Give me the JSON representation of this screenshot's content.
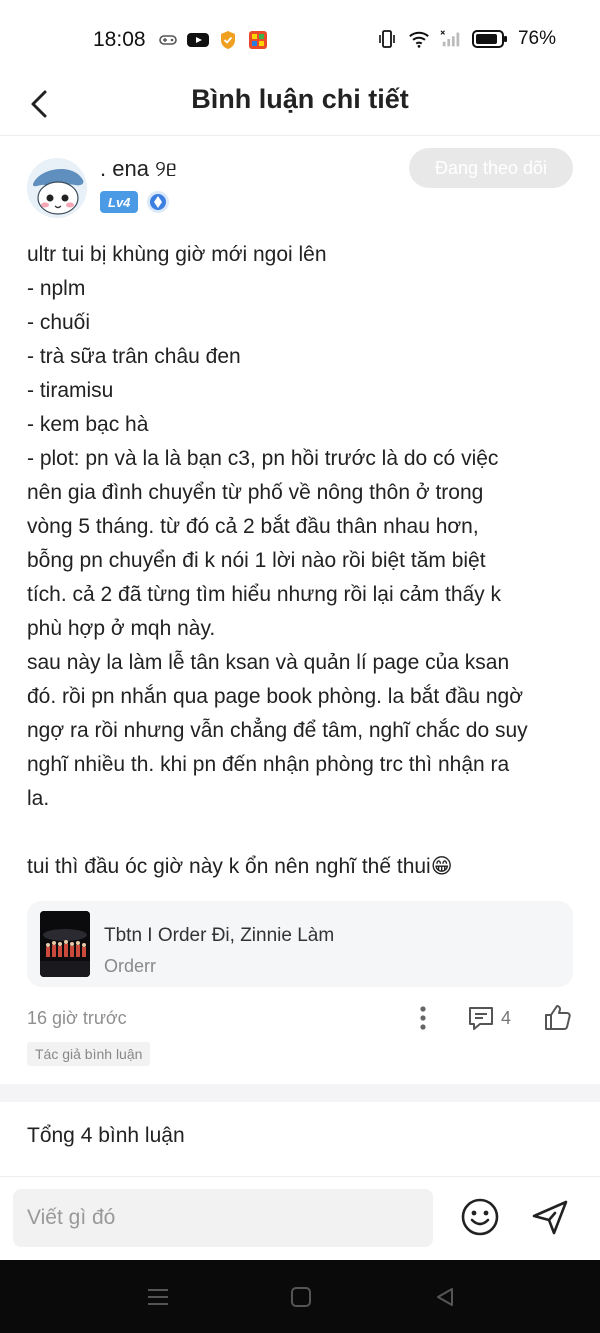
{
  "status_bar": {
    "time": "18:08",
    "battery": "76%"
  },
  "header": {
    "title": "Bình luận chi tiết",
    "back_icon": "chevron-left-icon"
  },
  "comment": {
    "author": ". ena ୨ᥱ",
    "level": "Lv4",
    "follow_label": "Đang theo dõi",
    "lines": [
      "ultr tui bị khùng giờ mới ngoi lên",
      "- nplm",
      "- chuối",
      "- trà sữa trân châu đen",
      "- tiramisu",
      "- kem bạc hà",
      "- plot: pn và la là bạn c3, pn hồi trước là do có việc",
      "nên gia đình chuyển từ phố về nông thôn ở trong",
      "vòng 5 tháng. từ đó cả 2 bắt đầu thân nhau hơn,",
      "bỗng pn chuyển đi k nói 1 lời nào rồi biệt tăm biệt",
      "tích. cả 2 đã từng tìm hiểu nhưng rồi lại cảm thấy k",
      "phù hợp ở mqh này.",
      "sau này la làm lễ tân ksan và quản lí page của ksan",
      "đó. rồi pn nhắn qua page book phòng. la bắt đầu ngờ",
      "ngợ ra rồi nhưng vẫn chẳng để tâm, nghĩ chắc do suy",
      "nghĩ nhiều th. khi pn đến nhận phòng trc thì nhận ra",
      "la.",
      "",
      "tui thì đầu óc giờ này k ổn nên nghĩ thế thui😁"
    ],
    "song": {
      "title": "Tbtn I Order Đi, Zinnie Làm",
      "artist": "Orderr"
    },
    "timestamp": "16 giờ trước",
    "reply_count": "4",
    "author_tag": "Tác giả bình luận"
  },
  "total_comments": "Tổng 4 bình luận",
  "input": {
    "placeholder": "Viết gì đó"
  }
}
